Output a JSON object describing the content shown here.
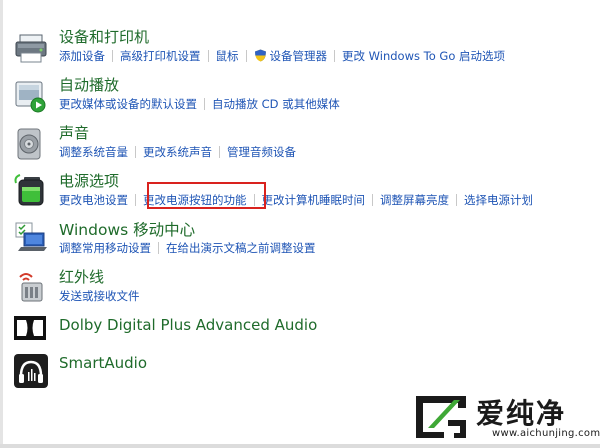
{
  "items": [
    {
      "title": "设备和打印机",
      "links": [
        "添加设备",
        "高级打印机设置",
        "鼠标",
        "设备管理器",
        "更改 Windows To Go 启动选项"
      ],
      "shield_index": 3
    },
    {
      "title": "自动播放",
      "links": [
        "更改媒体或设备的默认设置",
        "自动播放 CD 或其他媒体"
      ]
    },
    {
      "title": "声音",
      "links": [
        "调整系统音量",
        "更改系统声音",
        "管理音频设备"
      ]
    },
    {
      "title": "电源选项",
      "links": [
        "更改电池设置",
        "更改电源按钮的功能",
        "更改计算机睡眠时间",
        "调整屏幕亮度",
        "选择电源计划"
      ],
      "highlighted_index": 1
    },
    {
      "title": "Windows 移动中心",
      "links": [
        "调整常用移动设置",
        "在给出演示文稿之前调整设置"
      ]
    },
    {
      "title": "红外线",
      "links": [
        "发送或接收文件"
      ]
    },
    {
      "title": "Dolby Digital Plus Advanced Audio",
      "links": []
    },
    {
      "title": "SmartAudio",
      "links": []
    }
  ],
  "watermark": {
    "text_cn": "爱纯净",
    "url": "www.aichunjing.com"
  },
  "colors": {
    "title": "#1f6b2b",
    "link": "#1f55b5",
    "highlight": "#d9221e"
  }
}
